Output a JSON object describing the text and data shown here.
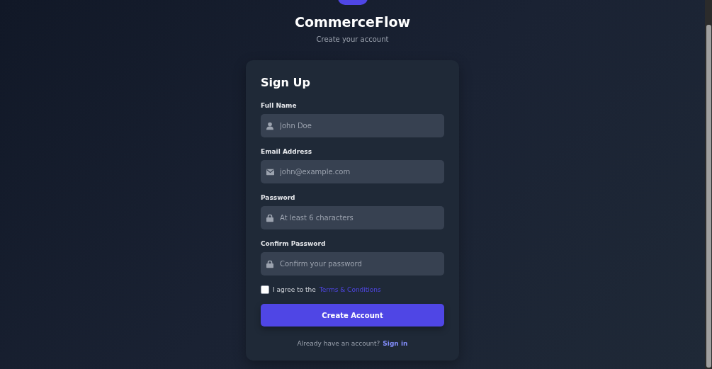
{
  "brand": {
    "title": "CommerceFlow",
    "subtitle": "Create your account"
  },
  "form": {
    "title": "Sign Up",
    "fields": [
      {
        "label": "Full Name",
        "placeholder": "John Doe",
        "kind": "person"
      },
      {
        "label": "Email Address",
        "placeholder": "john@example.com",
        "kind": "mail"
      },
      {
        "label": "Password",
        "placeholder": "At least 6 characters",
        "kind": "lock"
      },
      {
        "label": "Confirm Password",
        "placeholder": "Confirm your password",
        "kind": "lock"
      }
    ],
    "terms": {
      "checked": false,
      "text": "I agree to the",
      "link": "Terms & Conditions"
    },
    "submit": "Create Account",
    "footer": {
      "text": "Already have an account?",
      "link": "Sign in"
    }
  }
}
